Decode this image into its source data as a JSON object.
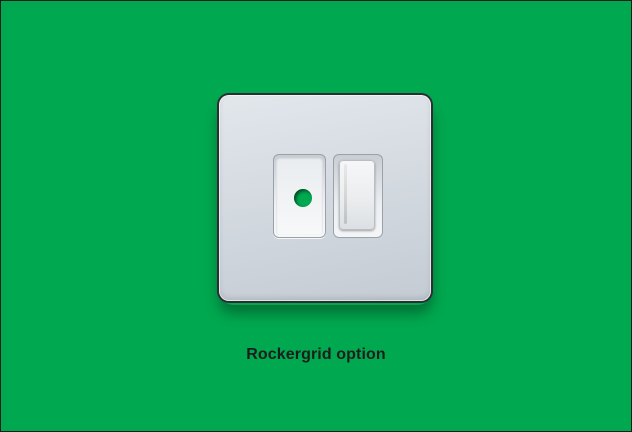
{
  "caption": "Rockergrid option",
  "colors": {
    "background": "#00a84f",
    "border": "#1d1d1b",
    "caption_text": "#1d1d1b"
  },
  "product": {
    "icon": "socket-plate-with-rocker-switch"
  }
}
